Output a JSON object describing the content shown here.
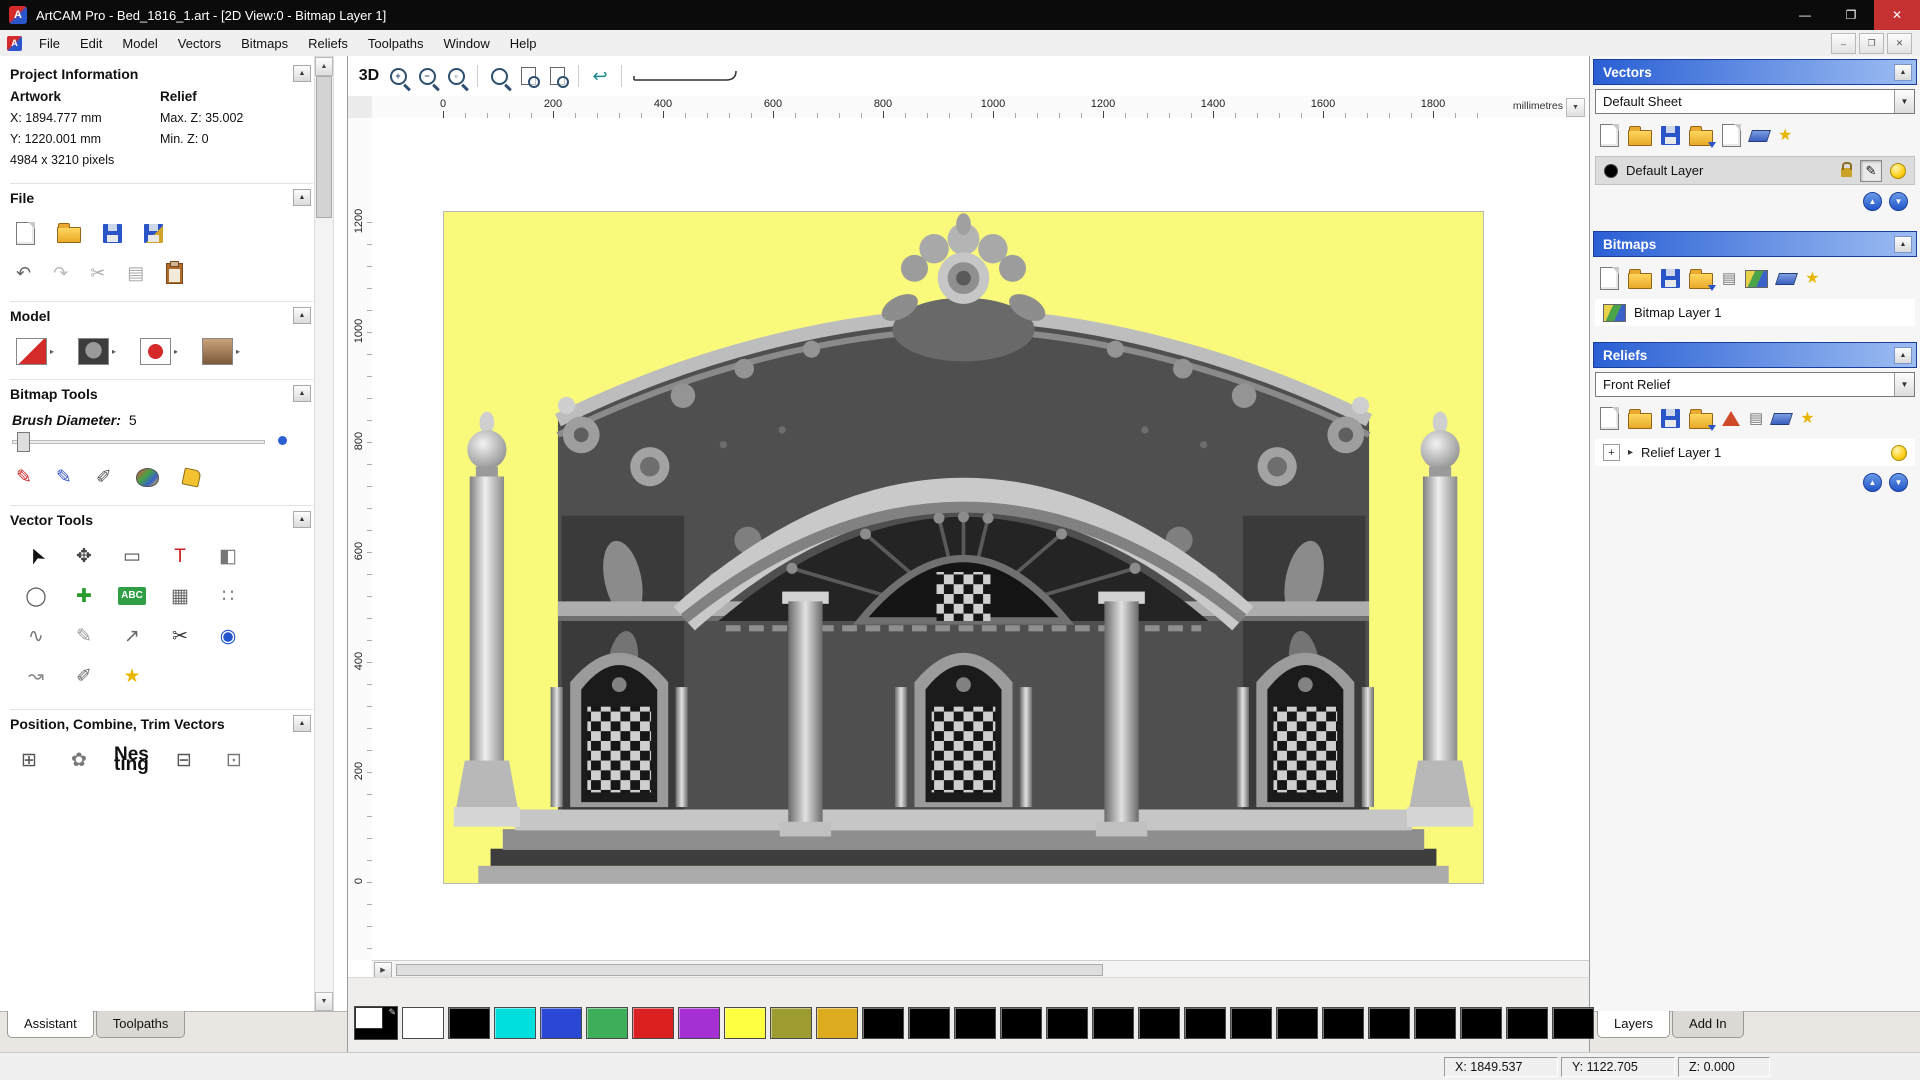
{
  "titlebar": {
    "title": "ArtCAM Pro - Bed_1816_1.art - [2D View:0 - Bitmap Layer 1]",
    "logo_letter": "A",
    "controls": {
      "minimize": "—",
      "maximize": "❐",
      "close": "✕"
    }
  },
  "menu": {
    "items": [
      "File",
      "Edit",
      "Model",
      "Vectors",
      "Bitmaps",
      "Reliefs",
      "Toolpaths",
      "Window",
      "Help"
    ],
    "mdi": {
      "minimize": "–",
      "restore": "❐",
      "close": "✕"
    }
  },
  "left": {
    "project": {
      "title": "Project Information",
      "artwork_header": "Artwork",
      "relief_header": "Relief",
      "x": "X: 1894.777 mm",
      "max_z": "Max. Z: 35.002",
      "y": "Y: 1220.001 mm",
      "min_z": "Min. Z: 0",
      "pixels": "4984 x 3210 pixels"
    },
    "file": {
      "title": "File"
    },
    "model": {
      "title": "Model"
    },
    "bitmap": {
      "title": "Bitmap Tools",
      "brush_label": "Brush Diameter:",
      "brush_value": "5"
    },
    "vector": {
      "title": "Vector Tools"
    },
    "position": {
      "title": "Position, Combine, Trim Vectors"
    },
    "tabs": [
      {
        "name": "tab-assistant",
        "label": "Assistant",
        "active": true
      },
      {
        "name": "tab-toolpaths",
        "label": "Toolpaths",
        "active": false
      }
    ]
  },
  "viewport": {
    "toolbar": {
      "btn_3d": "3D"
    },
    "ruler": {
      "h_ticks": [
        "0",
        "200",
        "400",
        "600",
        "800",
        "1000",
        "1200",
        "1400",
        "1600",
        "1800"
      ],
      "v_ticks": [
        "1200",
        "1000",
        "800",
        "600",
        "400",
        "200",
        "0"
      ],
      "units": "millimetres"
    }
  },
  "right": {
    "vectors": {
      "title": "Vectors",
      "sheet": "Default Sheet",
      "layer": {
        "name": "Default Layer"
      }
    },
    "bitmaps": {
      "title": "Bitmaps",
      "layer": {
        "name": "Bitmap Layer 1"
      }
    },
    "reliefs": {
      "title": "Reliefs",
      "selected": "Front Relief",
      "layer": {
        "name": "Relief Layer 1"
      }
    },
    "tabs": [
      {
        "name": "tab-layers",
        "label": "Layers",
        "active": true
      },
      {
        "name": "tab-add-in",
        "label": "Add In",
        "active": false
      }
    ]
  },
  "palette": {
    "swatches": [
      "#ffffff",
      "#000000",
      "#00dede",
      "#2b47d6",
      "#3fae5a",
      "#da2020",
      "#a62fd4",
      "#ffff42",
      "#9c9c30",
      "#ddab1e",
      "#000000",
      "#000000",
      "#000000",
      "#000000",
      "#000000",
      "#000000",
      "#000000",
      "#000000",
      "#000000",
      "#000000",
      "#000000",
      "#000000",
      "#000000",
      "#000000",
      "#000000",
      "#000000"
    ]
  },
  "status": {
    "x": "X: 1849.537",
    "y": "Y: 1122.705",
    "z": "Z: 0.000"
  },
  "icons": {
    "undo": "↶",
    "redo": "↷",
    "cut": "✂",
    "copy": "▤",
    "back": "↩",
    "star": "★",
    "dropdown": "▼",
    "roll_up": "▲",
    "expand": "▸",
    "pencil": "✎",
    "up": "▲",
    "down": "▼",
    "scroll_right": "▶",
    "scroll_up": "▲",
    "scroll_down": "▼",
    "plus": "+"
  },
  "paint_tools": [
    {
      "name": "draw-tool-icon",
      "glyph": "✎",
      "color": "#cc2020"
    },
    {
      "name": "paint-tool-icon",
      "glyph": "✎",
      "color": "#3355cc"
    },
    {
      "name": "colour-picker-icon",
      "glyph": "✐",
      "color": "#555555"
    },
    {
      "name": "palette-icon",
      "glyph": "",
      "color": ""
    },
    {
      "name": "flood-fill-icon",
      "glyph": "",
      "color": ""
    }
  ],
  "vector_tools": [
    {
      "name": "select-cursor-icon",
      "glyph": "➤",
      "color": "#111111"
    },
    {
      "name": "transform-icon",
      "glyph": "✥",
      "color": "#444444"
    },
    {
      "name": "rectangle-tool-icon",
      "glyph": "▭",
      "color": "#555555"
    },
    {
      "name": "text-tool-icon",
      "glyph": "T",
      "color": "#cc2222"
    },
    {
      "name": "mirror-tool-icon",
      "glyph": "◧",
      "color": "#777777"
    },
    {
      "name": "ellipse-tool-icon",
      "glyph": "◯",
      "color": "#555555"
    },
    {
      "name": "node-add-icon",
      "glyph": "✚",
      "color": "#2a9a2a"
    },
    {
      "name": "text-abc-icon",
      "glyph": "ABC",
      "color": "#ffffff"
    },
    {
      "name": "distort-tool-icon",
      "glyph": "▦",
      "color": "#666666"
    },
    {
      "name": "array-dots-icon",
      "glyph": "∷",
      "color": "#888888"
    },
    {
      "name": "polyline-tool-icon",
      "glyph": "∿",
      "color": "#777777"
    },
    {
      "name": "node-edit-icon",
      "glyph": "✎",
      "color": "#999999"
    },
    {
      "name": "arc-tool-icon",
      "glyph": "↗",
      "color": "#666666"
    },
    {
      "name": "trim-tool-icon",
      "glyph": "✂",
      "color": "#333333"
    },
    {
      "name": "extrude-tool-icon",
      "glyph": "◉",
      "color": "#2255cc"
    },
    {
      "name": "freehand-tool-icon",
      "glyph": "↝",
      "color": "#888888"
    },
    {
      "name": "measure-tool-icon",
      "glyph": "✐",
      "color": "#666666"
    },
    {
      "name": "star-tool-icon",
      "glyph": "★",
      "color": "#e8b500"
    }
  ],
  "position_tools": [
    {
      "name": "align-tool-icon",
      "glyph": "⊞",
      "color": "#555555"
    },
    {
      "name": "circular-array-icon",
      "glyph": "✿",
      "color": "#777777"
    },
    {
      "name": "nesting-icon",
      "glyph": "Nes\nting",
      "color": "#111111"
    },
    {
      "name": "block-array-icon",
      "glyph": "⊟",
      "color": "#555555"
    },
    {
      "name": "weld-vectors-icon",
      "glyph": "⊡",
      "color": "#777777"
    }
  ]
}
